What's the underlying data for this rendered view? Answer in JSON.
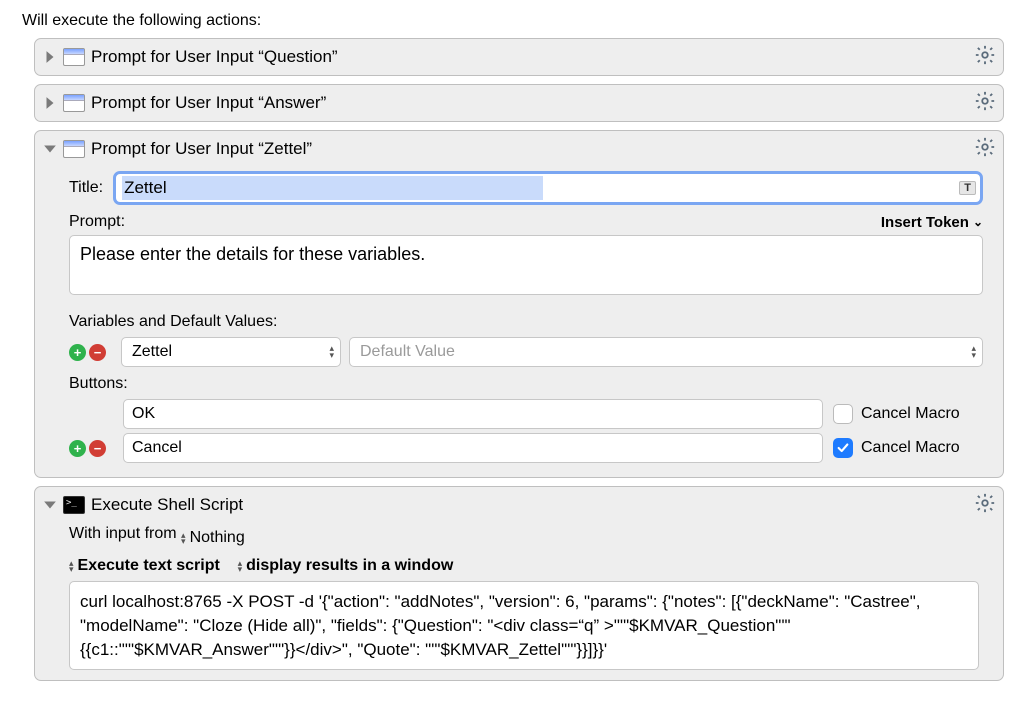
{
  "intro": "Will execute the following actions:",
  "actions": {
    "prompt_question": {
      "title": "Prompt for User Input “Question”"
    },
    "prompt_answer": {
      "title": "Prompt for User Input “Answer”"
    },
    "prompt_zettel": {
      "title": "Prompt for User Input “Zettel”",
      "title_label": "Title:",
      "title_value": "Zettel",
      "token_badge": "T",
      "prompt_label": "Prompt:",
      "insert_token": "Insert Token",
      "prompt_text": "Please enter the details for these variables.",
      "vars_label": "Variables and Default Values:",
      "var_name": "Zettel",
      "default_placeholder": "Default Value",
      "buttons_label": "Buttons:",
      "rows": [
        {
          "label": "OK",
          "cancel_checked": false,
          "show_addrem": false
        },
        {
          "label": "Cancel",
          "cancel_checked": true,
          "show_addrem": true
        }
      ],
      "cancel_macro_label": "Cancel Macro"
    },
    "shell": {
      "title": "Execute Shell Script",
      "with_input_label": "With input from",
      "with_input_value": "Nothing",
      "opt1": "Execute text script",
      "opt2": "display results in a window",
      "script": "curl localhost:8765 -X POST -d '{\"action\": \"addNotes\", \"version\": 6, \"params\": {\"notes\": [{\"deckName\": \"Castree\", \"modelName\": \"Cloze (Hide all)\", \"fields\": {\"Question\": \"<div class=“q” >\"'\"$KMVAR_Question\"'\"{{c1::\"'\"$KMVAR_Answer\"'\"}}</div>\", \"Quote\": \"'\"$KMVAR_Zettel\"'\"}}]}}'"
    }
  }
}
